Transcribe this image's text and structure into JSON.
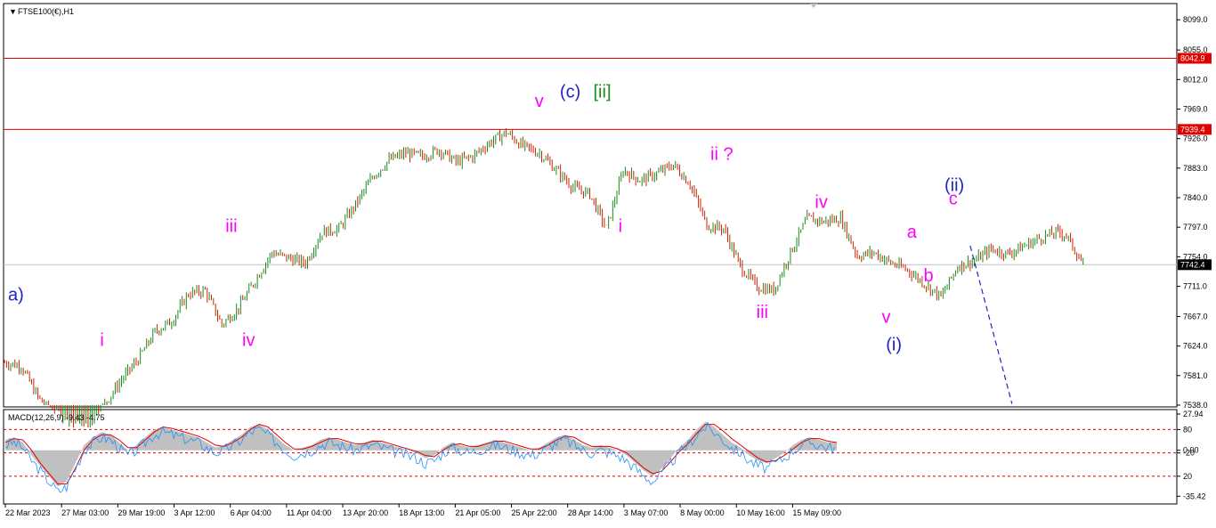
{
  "chart_data": {
    "type": "line",
    "symbol_label": "FTSE100(€),H1",
    "ylim": [
      7538,
      8120
    ],
    "y_ticks": [
      "8099.0",
      "8055.0",
      "8012.0",
      "7969.0",
      "7926.0",
      "7883.0",
      "7840.0",
      "7797.0",
      "7754.0",
      "7711.0",
      "7667.0",
      "7624.0",
      "7581.0",
      "7538.0"
    ],
    "y_tick_values": [
      8099,
      8055,
      8012,
      7969,
      7926,
      7883,
      7840,
      7797,
      7754,
      7711,
      7667,
      7624,
      7581,
      7538
    ],
    "x_ticks": [
      "22 Mar 2023",
      "27 Mar 03:00",
      "29 Mar 19:00",
      "3 Apr 12:00",
      "6 Apr 04:00",
      "11 Apr 04:00",
      "13 Apr 20:00",
      "18 Apr 13:00",
      "21 Apr 05:00",
      "25 Apr 22:00",
      "28 Apr 14:00",
      "3 May 07:00",
      "8 May 00:00",
      "10 May 16:00",
      "15 May 09:00"
    ],
    "resistance_levels": [
      {
        "value": 8042.9,
        "label": "8042.9",
        "color": "#e00000"
      },
      {
        "value": 7939.4,
        "label": "7939.4",
        "color": "#e00000"
      }
    ],
    "current_price": {
      "value": 7742.4,
      "label": "7742.4"
    },
    "price_path": [
      [
        0,
        7600
      ],
      [
        4,
        7595
      ],
      [
        8,
        7550
      ],
      [
        12,
        7520
      ],
      [
        16,
        7505
      ],
      [
        20,
        7500
      ],
      [
        24,
        7540
      ],
      [
        28,
        7575
      ],
      [
        32,
        7605
      ],
      [
        36,
        7645
      ],
      [
        40,
        7660
      ],
      [
        44,
        7700
      ],
      [
        48,
        7705
      ],
      [
        52,
        7655
      ],
      [
        56,
        7680
      ],
      [
        60,
        7720
      ],
      [
        64,
        7760
      ],
      [
        68,
        7752
      ],
      [
        72,
        7745
      ],
      [
        76,
        7790
      ],
      [
        80,
        7795
      ],
      [
        84,
        7830
      ],
      [
        88,
        7870
      ],
      [
        92,
        7895
      ],
      [
        96,
        7905
      ],
      [
        100,
        7900
      ],
      [
        104,
        7910
      ],
      [
        108,
        7892
      ],
      [
        112,
        7900
      ],
      [
        116,
        7920
      ],
      [
        120,
        7935
      ],
      [
        124,
        7915
      ],
      [
        128,
        7905
      ],
      [
        132,
        7880
      ],
      [
        136,
        7855
      ],
      [
        140,
        7845
      ],
      [
        144,
        7795
      ],
      [
        148,
        7880
      ],
      [
        152,
        7865
      ],
      [
        156,
        7875
      ],
      [
        160,
        7888
      ],
      [
        164,
        7860
      ],
      [
        168,
        7800
      ],
      [
        172,
        7795
      ],
      [
        176,
        7740
      ],
      [
        180,
        7710
      ],
      [
        184,
        7705
      ],
      [
        188,
        7760
      ],
      [
        192,
        7810
      ],
      [
        196,
        7805
      ],
      [
        200,
        7810
      ],
      [
        204,
        7755
      ],
      [
        208,
        7760
      ],
      [
        212,
        7745
      ],
      [
        216,
        7735
      ],
      [
        220,
        7715
      ],
      [
        224,
        7695
      ],
      [
        228,
        7740
      ],
      [
        232,
        7748
      ],
      [
        236,
        7765
      ],
      [
        240,
        7758
      ],
      [
        244,
        7770
      ],
      [
        248,
        7782
      ],
      [
        252,
        7790
      ],
      [
        254,
        7785
      ],
      [
        258,
        7742
      ]
    ],
    "x_domain": [
      0,
      280
    ],
    "wave_labels": [
      {
        "text": "a)",
        "color": "#1e24c8",
        "x": 0,
        "y": 7690
      },
      {
        "text": "i",
        "color": "#ff00ff",
        "x": 22,
        "y": 7624
      },
      {
        "text": "iii",
        "color": "#ff00ff",
        "x": 52,
        "y": 7790
      },
      {
        "text": "iv",
        "color": "#ff00ff",
        "x": 56,
        "y": 7624
      },
      {
        "text": "v",
        "color": "#ff00ff",
        "x": 126,
        "y": 7972
      },
      {
        "text": "(c)",
        "color": "#1e24c8",
        "x": 132,
        "y": 7986
      },
      {
        "text": "[ii]",
        "color": "#1a8a1a",
        "x": 140,
        "y": 7986
      },
      {
        "text": "i",
        "color": "#ff00ff",
        "x": 146,
        "y": 7790
      },
      {
        "text": "ii ?",
        "color": "#ff00ff",
        "x": 168,
        "y": 7895
      },
      {
        "text": "iv",
        "color": "#ff00ff",
        "x": 193,
        "y": 7825
      },
      {
        "text": "iii",
        "color": "#ff00ff",
        "x": 179,
        "y": 7665
      },
      {
        "text": "v",
        "color": "#ff00ff",
        "x": 209,
        "y": 7658
      },
      {
        "text": "(i)",
        "color": "#1e24c8",
        "x": 210,
        "y": 7618
      },
      {
        "text": "a",
        "color": "#ff00ff",
        "x": 215,
        "y": 7782
      },
      {
        "text": "b",
        "color": "#ff00ff",
        "x": 219,
        "y": 7718
      },
      {
        "text": "(ii)",
        "color": "#1e24c8",
        "x": 224,
        "y": 7850
      },
      {
        "text": "c",
        "color": "#ff00ff",
        "x": 225,
        "y": 7830
      }
    ],
    "projection": {
      "color": "#1e24c8",
      "points": [
        [
          231,
          7770
        ],
        [
          241,
          7540
        ]
      ]
    },
    "grid": false,
    "macd": {
      "label": "MACD(12,26,9) -9.43 -4.75",
      "ylim": [
        -40,
        30
      ],
      "ticks": [
        "27.94",
        "80",
        "0.00",
        "-20",
        "20",
        "-35.42"
      ],
      "tick_values": [
        27.94,
        16,
        0,
        -2,
        -20,
        -35.42
      ],
      "levels": [
        16,
        -2,
        -20
      ],
      "histogram": [
        8,
        10,
        6,
        -4,
        -12,
        -20,
        -28,
        -24,
        -10,
        4,
        10,
        14,
        12,
        6,
        0,
        4,
        10,
        16,
        18,
        16,
        14,
        12,
        10,
        6,
        2,
        4,
        8,
        12,
        18,
        20,
        16,
        10,
        4,
        0,
        2,
        4,
        8,
        10,
        8,
        6,
        4,
        6,
        8,
        6,
        4,
        2,
        0,
        -2,
        -6,
        -4,
        2,
        6,
        4,
        2,
        4,
        6,
        8,
        6,
        4,
        2,
        0,
        2,
        6,
        10,
        12,
        8,
        4,
        2,
        4,
        2,
        0,
        -4,
        -10,
        -16,
        -20,
        -14,
        -6,
        2,
        8,
        16,
        22,
        18,
        12,
        6,
        2,
        -4,
        -8,
        -10,
        -6,
        -2,
        4,
        8,
        10,
        8,
        6,
        6
      ],
      "signal": [
        6,
        9,
        8,
        0,
        -10,
        -18,
        -26,
        -26,
        -14,
        0,
        8,
        12,
        12,
        8,
        2,
        2,
        8,
        14,
        18,
        17,
        15,
        13,
        11,
        8,
        4,
        3,
        6,
        10,
        16,
        20,
        18,
        12,
        6,
        1,
        1,
        3,
        6,
        9,
        9,
        7,
        5,
        5,
        7,
        7,
        5,
        3,
        1,
        -1,
        -4,
        -5,
        0,
        4,
        5,
        3,
        3,
        5,
        7,
        7,
        5,
        3,
        1,
        1,
        4,
        8,
        11,
        10,
        6,
        3,
        3,
        3,
        1,
        -2,
        -8,
        -14,
        -18,
        -16,
        -9,
        -1,
        5,
        13,
        20,
        20,
        15,
        9,
        4,
        -1,
        -6,
        -9,
        -8,
        -4,
        1,
        6,
        9,
        9,
        7,
        6
      ]
    }
  }
}
